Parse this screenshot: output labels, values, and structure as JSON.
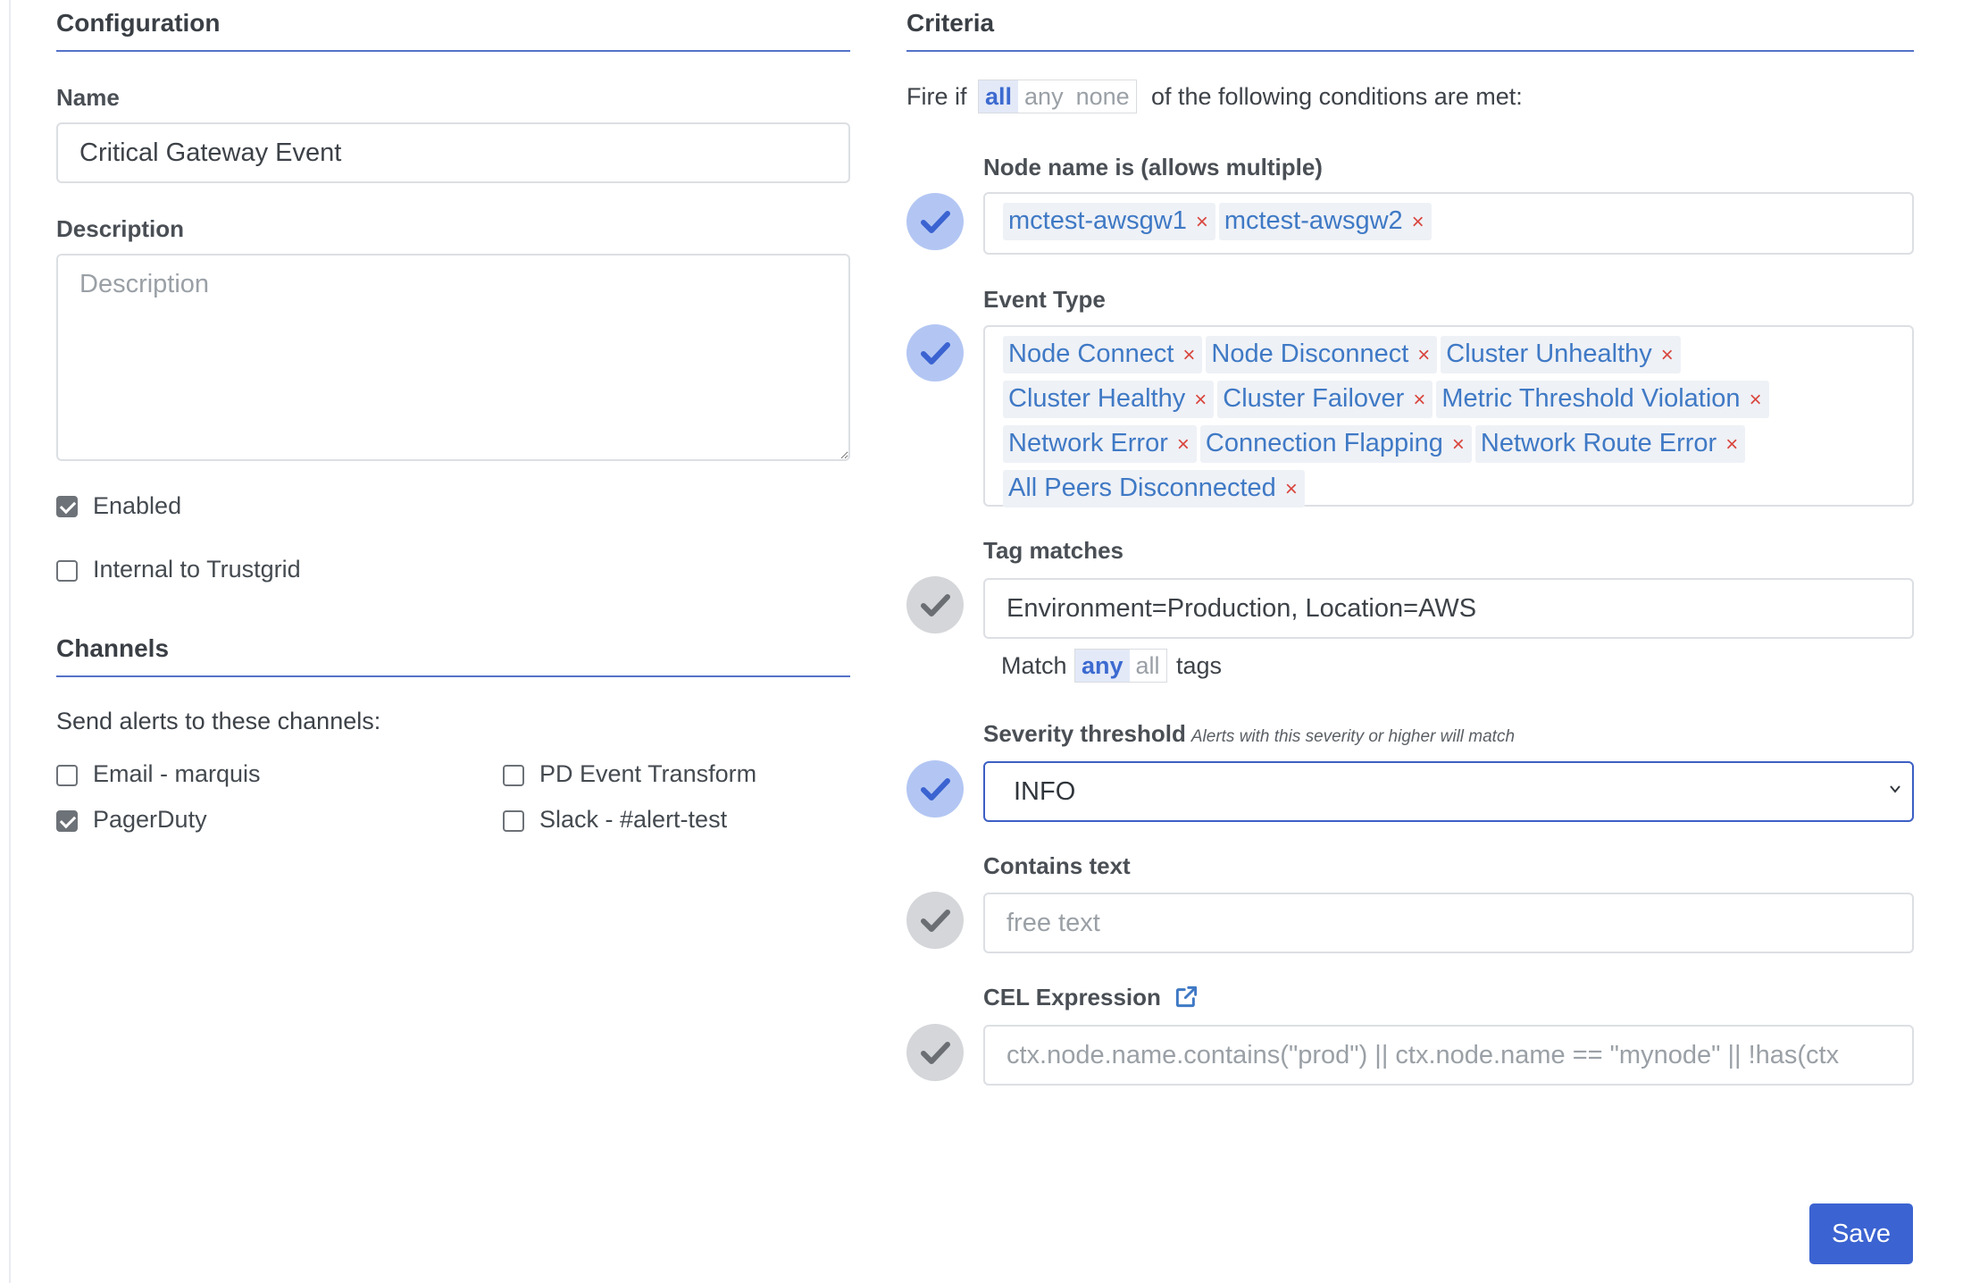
{
  "configuration": {
    "title": "Configuration",
    "name_label": "Name",
    "name_value": "Critical Gateway Event",
    "description_label": "Description",
    "description_placeholder": "Description",
    "enabled_label": "Enabled",
    "enabled_checked": true,
    "internal_label": "Internal to Trustgrid",
    "internal_checked": false
  },
  "channels": {
    "title": "Channels",
    "intro": "Send alerts to these channels:",
    "items": [
      {
        "label": "Email - marquis",
        "checked": false
      },
      {
        "label": "PD Event Transform",
        "checked": false
      },
      {
        "label": "PagerDuty",
        "checked": true
      },
      {
        "label": "Slack - #alert-test",
        "checked": false
      }
    ]
  },
  "criteria": {
    "title": "Criteria",
    "fire_prefix": "Fire if",
    "fire_options": [
      "all",
      "any",
      "none"
    ],
    "fire_selected": "all",
    "fire_suffix": "of the following conditions are met:",
    "node_name": {
      "label": "Node name is (allows multiple)",
      "enabled": true,
      "values": [
        "mctest-awsgw1",
        "mctest-awsgw2"
      ]
    },
    "event_type": {
      "label": "Event Type",
      "enabled": true,
      "values": [
        "Node Connect",
        "Node Disconnect",
        "Cluster Unhealthy",
        "Cluster Healthy",
        "Cluster Failover",
        "Metric Threshold Violation",
        "Network Error",
        "Connection Flapping",
        "Network Route Error",
        "All Peers Disconnected"
      ]
    },
    "tag_matches": {
      "label": "Tag matches",
      "enabled": false,
      "value": "Environment=Production, Location=AWS",
      "match_prefix": "Match",
      "match_options": [
        "any",
        "all"
      ],
      "match_selected": "any",
      "match_suffix": "tags"
    },
    "severity": {
      "label": "Severity threshold",
      "hint": "Alerts with this severity or higher will match",
      "enabled": true,
      "value": "INFO"
    },
    "contains_text": {
      "label": "Contains text",
      "enabled": false,
      "placeholder": "free text"
    },
    "cel": {
      "label": "CEL Expression",
      "enabled": false,
      "placeholder": "ctx.node.name.contains(\"prod\") || ctx.node.name == \"mynode\" || !has(ctx"
    }
  },
  "colors": {
    "accent": "#3b63d1",
    "chip_text": "#3f79c5",
    "chip_remove": "#d9453d",
    "toggle_on": "#b3c6f3",
    "toggle_off": "#d4d6d9"
  },
  "actions": {
    "save_label": "Save"
  }
}
